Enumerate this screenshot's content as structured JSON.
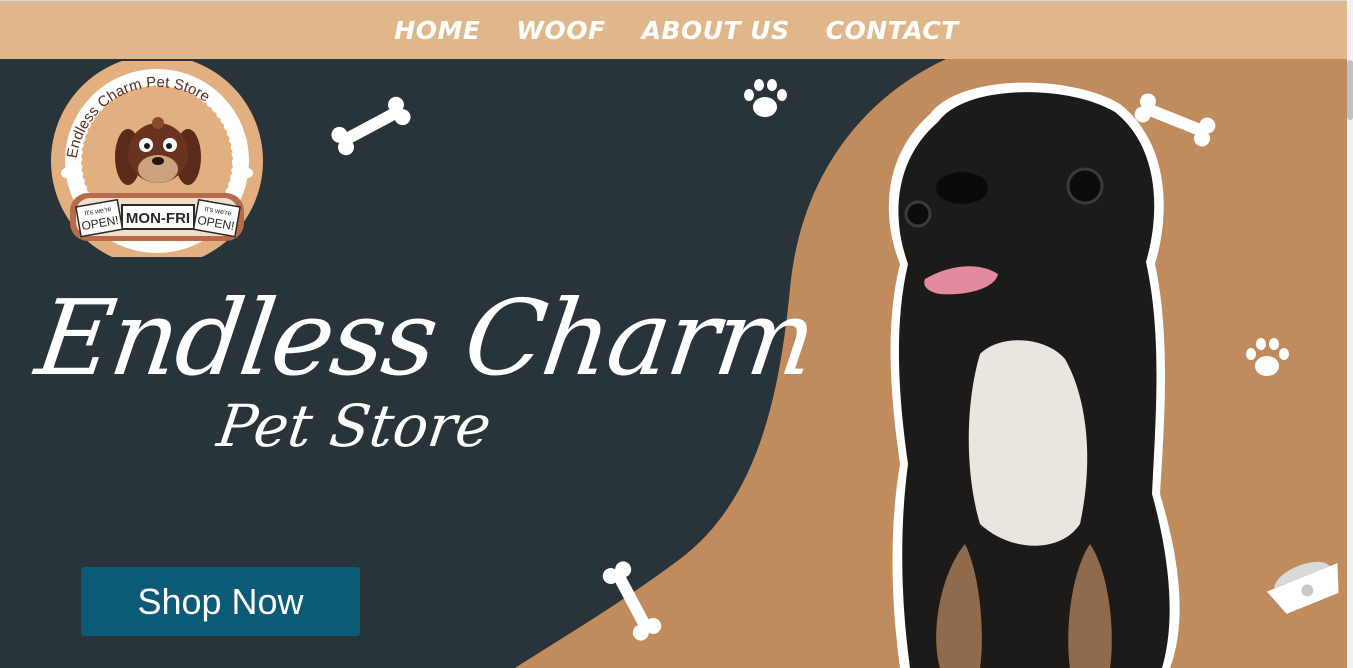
{
  "nav": {
    "items": [
      "HOME",
      "WOOF",
      "ABOUT US",
      "CONTACT"
    ]
  },
  "logo": {
    "arc_text": "Endless Charm Pet Store",
    "sign_left": "OPEN!",
    "sign_left_small": "It's we're",
    "sign_center": "MON-FRI",
    "sign_right": "OPEN!",
    "sign_right_small": "It's we're"
  },
  "hero": {
    "title": "Endless Charm",
    "subtitle": "Pet Store",
    "cta_label": "Shop Now"
  },
  "colors": {
    "nav_bg": "#e0b78a",
    "hero_dark": "#28343a",
    "hero_tan": "#c18c5d",
    "cta": "#0b5a77"
  },
  "icons": [
    "bone-icon",
    "paw-icon",
    "food-bowl-icon",
    "dog-photo"
  ]
}
